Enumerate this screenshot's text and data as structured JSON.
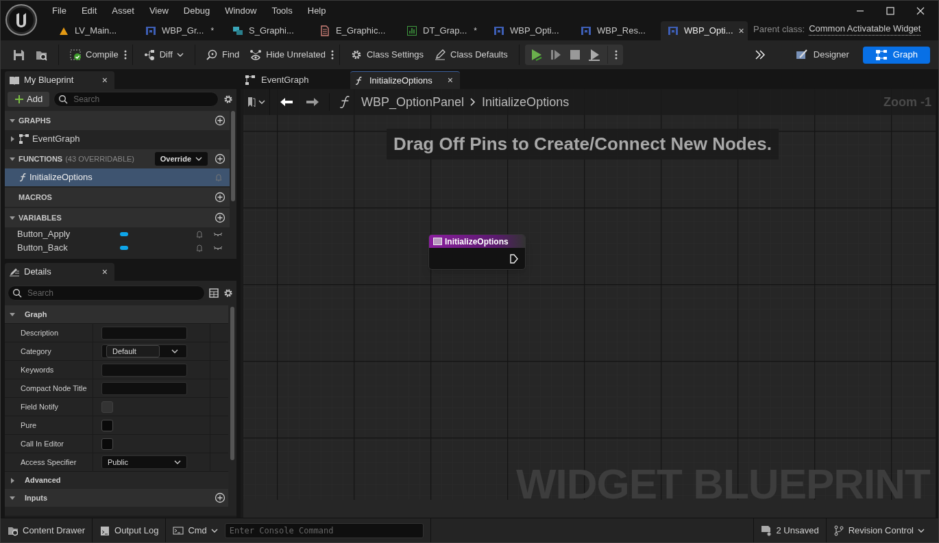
{
  "menu": [
    "File",
    "Edit",
    "Asset",
    "View",
    "Debug",
    "Window",
    "Tools",
    "Help"
  ],
  "doc_tabs": [
    {
      "label": "LV_Main...",
      "kind": "level",
      "selected": false
    },
    {
      "label": "WBP_Gr...",
      "kind": "widget",
      "modified_mark": "*",
      "selected": false
    },
    {
      "label": "S_Graphi...",
      "kind": "struct",
      "selected": false
    },
    {
      "label": "E_Graphic...",
      "kind": "enum",
      "selected": false
    },
    {
      "label": "DT_Grap...",
      "kind": "datatable",
      "modified_mark": "*",
      "selected": false
    },
    {
      "label": "WBP_Opti...",
      "kind": "widget",
      "selected": false
    },
    {
      "label": "WBP_Res...",
      "kind": "widget",
      "selected": false
    },
    {
      "label": "WBP_Opti...",
      "kind": "widget",
      "selected": true,
      "close": "×"
    }
  ],
  "parent_class": {
    "label": "Parent class:",
    "value": "Common Activatable Widget"
  },
  "toolbar": [
    {
      "kind": "save"
    },
    {
      "kind": "browse"
    },
    {
      "kind": "compile",
      "label": "Compile",
      "more": true
    },
    {
      "kind": "diff",
      "label": "Diff",
      "dropdown": true
    },
    {
      "kind": "find",
      "label": "Find"
    },
    {
      "kind": "hide",
      "label": "Hide Unrelated",
      "more": true
    },
    {
      "kind": "settings",
      "label": "Class Settings"
    },
    {
      "kind": "defaults",
      "label": "Class Defaults"
    }
  ],
  "play_controls": [
    {
      "kind": "play"
    },
    {
      "kind": "step"
    },
    {
      "kind": "stop"
    },
    {
      "kind": "eject"
    }
  ],
  "modes": [
    {
      "label": "Designer",
      "kind": "designer",
      "selected": false
    },
    {
      "label": "Graph",
      "kind": "graph",
      "selected": true
    }
  ],
  "my_blueprint": {
    "title": "My Blueprint",
    "close": "×",
    "add": "Add",
    "search_placeholder": "Search",
    "sections": [
      {
        "title": "GRAPHS",
        "expanded": true,
        "add": true,
        "items": [
          {
            "label": "EventGraph",
            "kind": "graph",
            "expanded": false,
            "selected": false
          }
        ]
      },
      {
        "title": "FUNCTIONS",
        "note": "(43 OVERRIDABLE)",
        "override": "Override",
        "expanded": true,
        "add": true,
        "items": [
          {
            "label": "InitializeOptions",
            "kind": "function",
            "selected": true
          }
        ]
      },
      {
        "title": "MACROS",
        "add": true
      },
      {
        "title": "VARIABLES",
        "expanded": true,
        "add": true,
        "items": [
          {
            "label": "Button_Apply",
            "kind": "variable",
            "selected": false
          },
          {
            "label": "Button_Back",
            "kind": "variable",
            "selected": false
          }
        ]
      }
    ]
  },
  "details": {
    "title": "Details",
    "close": "×",
    "search_placeholder": "Search",
    "sections": [
      {
        "title": "Graph",
        "expanded": true,
        "add": false,
        "properties": [
          {
            "label": "Description",
            "kind": "text"
          },
          {
            "label": "Category",
            "kind": "combo",
            "value": "Default"
          },
          {
            "label": "Keywords",
            "kind": "text"
          },
          {
            "label": "Compact Node Title",
            "kind": "text"
          },
          {
            "label": "Field Notify",
            "kind": "checkbox",
            "checked": false,
            "disabled": true
          },
          {
            "label": "Pure",
            "kind": "checkbox",
            "checked": false,
            "disabled": false
          },
          {
            "label": "Call In Editor",
            "kind": "checkbox",
            "checked": false,
            "disabled": false
          },
          {
            "label": "Access Specifier",
            "kind": "dropdown",
            "value": "Public"
          }
        ]
      },
      {
        "title": "Advanced",
        "expanded": false,
        "add": false
      },
      {
        "title": "Inputs",
        "expanded": true,
        "add": true
      }
    ]
  },
  "graph_tabs": [
    {
      "label": "EventGraph",
      "kind": "graph",
      "selected": false
    },
    {
      "label": "InitializeOptions",
      "kind": "function",
      "selected": true,
      "close": "×"
    }
  ],
  "breadcrumb": {
    "path": [
      "WBP_OptionPanel",
      "InitializeOptions"
    ],
    "zoom": "Zoom -1"
  },
  "graph": {
    "hint": "Drag Off Pins to Create/Connect New Nodes.",
    "node": {
      "title": "InitializeOptions"
    },
    "watermark": "WIDGET BLUEPRINT"
  },
  "status_bar": {
    "content_drawer": "Content Drawer",
    "output_log": "Output Log",
    "cmd": "Cmd",
    "console_placeholder": "Enter Console Command",
    "unsaved": "2 Unsaved",
    "revision_control": "Revision Control"
  }
}
